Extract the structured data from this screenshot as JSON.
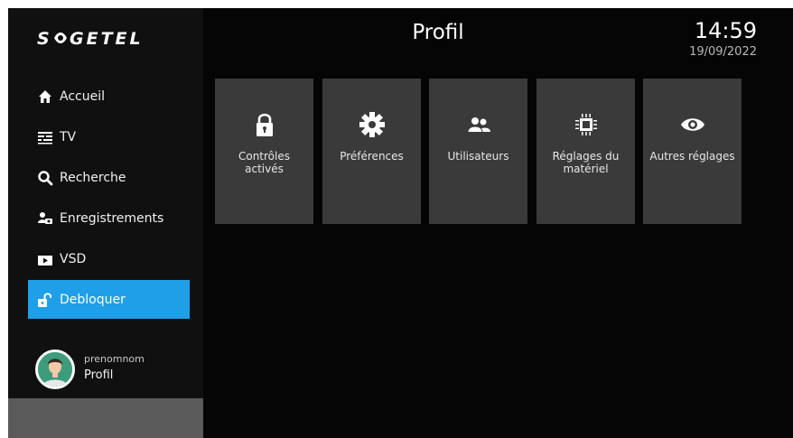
{
  "brand": {
    "logo_text": "S●GETEL"
  },
  "header": {
    "title": "Profil",
    "time": "14:59",
    "date": "19/09/2022"
  },
  "sidebar": {
    "items": [
      {
        "label": "Accueil",
        "icon": "home-icon"
      },
      {
        "label": "TV",
        "icon": "tv-guide-icon"
      },
      {
        "label": "Recherche",
        "icon": "search-icon"
      },
      {
        "label": "Enregistrements",
        "icon": "recordings-icon"
      },
      {
        "label": "VSD",
        "icon": "vod-icon"
      },
      {
        "label": "Debloquer",
        "icon": "unlock-icon",
        "active": true
      }
    ],
    "profile": {
      "username": "prenomnom",
      "label": "Profil"
    }
  },
  "tiles": [
    {
      "label_line1": "Contrôles",
      "label_line2": "activés",
      "icon": "lock-icon"
    },
    {
      "label_line1": "Préférences",
      "label_line2": "",
      "icon": "gear-icon"
    },
    {
      "label_line1": "Utilisateurs",
      "label_line2": "",
      "icon": "users-icon"
    },
    {
      "label_line1": "Réglages du",
      "label_line2": "matériel",
      "icon": "chip-icon"
    },
    {
      "label_line1": "Autres réglages",
      "label_line2": "",
      "icon": "eye-icon"
    }
  ],
  "colors": {
    "accent": "#1e9fe8",
    "tile": "#3a3a3a",
    "background": "#050505"
  }
}
